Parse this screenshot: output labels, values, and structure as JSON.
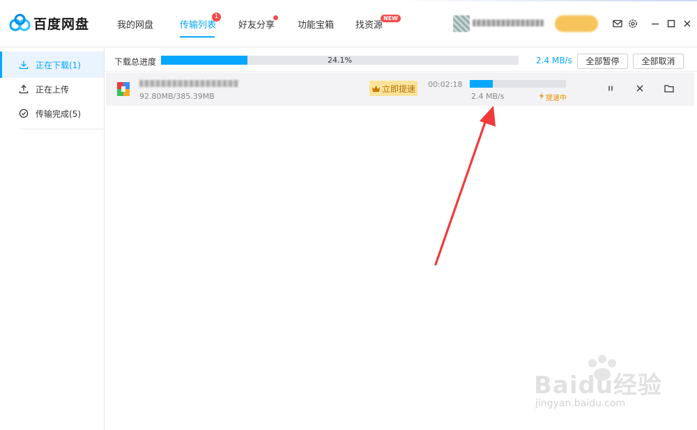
{
  "app": {
    "name": "百度网盘",
    "brand_color": "#06a7ff"
  },
  "nav": {
    "items": [
      {
        "label": "我的网盘"
      },
      {
        "label": "传输列表",
        "badge": "1"
      },
      {
        "label": "好友分享"
      },
      {
        "label": "功能宝箱"
      },
      {
        "label": "找资源",
        "badge": "NEW"
      }
    ],
    "active": "传输列表"
  },
  "sidebar": {
    "items": [
      {
        "label": "正在下载(1)",
        "icon": "download-icon"
      },
      {
        "label": "正在上传",
        "icon": "upload-icon"
      },
      {
        "label": "传输完成(5)",
        "icon": "check-circle-icon"
      }
    ]
  },
  "summary": {
    "label": "下载总进度",
    "progress": 0.241,
    "percent_text": "24.1%",
    "speed": "2.4 MB/s",
    "pause_all": "全部暂停",
    "cancel_all": "全部取消"
  },
  "task": {
    "size_text": "92.80MB/385.39MB",
    "boost_label": "立即提速",
    "remaining": "00:02:18",
    "progress": 0.241,
    "speed": "2.4 MB/s",
    "boosting_label": "提速中"
  },
  "watermark": {
    "title": "Baidu经验",
    "subtitle": "jingyan.baidu.com"
  }
}
